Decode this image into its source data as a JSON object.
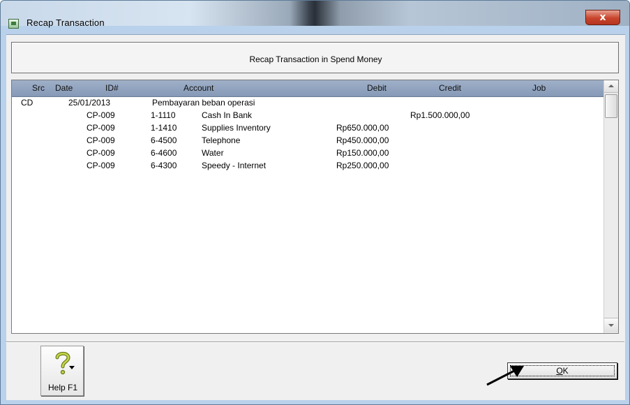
{
  "window": {
    "title": "Recap Transaction",
    "close_glyph": "x"
  },
  "header": {
    "title": "Recap Transaction in Spend Money"
  },
  "grid": {
    "columns": [
      "Src",
      "Date",
      "ID#",
      "Account",
      "Debit",
      "Credit",
      "Job"
    ],
    "rows": [
      {
        "src": "CD",
        "date": "25/01/2013",
        "id": "",
        "acct_no": "Pembayaran beban operasi",
        "acct_name": "",
        "debit": "",
        "credit": "",
        "job": ""
      },
      {
        "src": "",
        "date": "",
        "id": "CP-009",
        "acct_no": "1-1110",
        "acct_name": "Cash In Bank",
        "debit": "",
        "credit": "Rp1.500.000,00",
        "job": ""
      },
      {
        "src": "",
        "date": "",
        "id": "CP-009",
        "acct_no": "1-1410",
        "acct_name": "Supplies Inventory",
        "debit": "Rp650.000,00",
        "credit": "",
        "job": ""
      },
      {
        "src": "",
        "date": "",
        "id": "CP-009",
        "acct_no": "6-4500",
        "acct_name": "Telephone",
        "debit": "Rp450.000,00",
        "credit": "",
        "job": ""
      },
      {
        "src": "",
        "date": "",
        "id": "CP-009",
        "acct_no": "6-4600",
        "acct_name": "Water",
        "debit": "Rp150.000,00",
        "credit": "",
        "job": ""
      },
      {
        "src": "",
        "date": "",
        "id": "CP-009",
        "acct_no": "6-4300",
        "acct_name": "Speedy - Internet",
        "debit": "Rp250.000,00",
        "credit": "",
        "job": ""
      }
    ]
  },
  "buttons": {
    "help_label": "Help F1",
    "help_icon": "question-mark-icon",
    "ok_label_mnemonic": "O",
    "ok_label_rest": "K"
  },
  "colors": {
    "header_row": "#8fa2bd",
    "close_button": "#c8442c",
    "dialog_bg": "#f0f0f0"
  }
}
